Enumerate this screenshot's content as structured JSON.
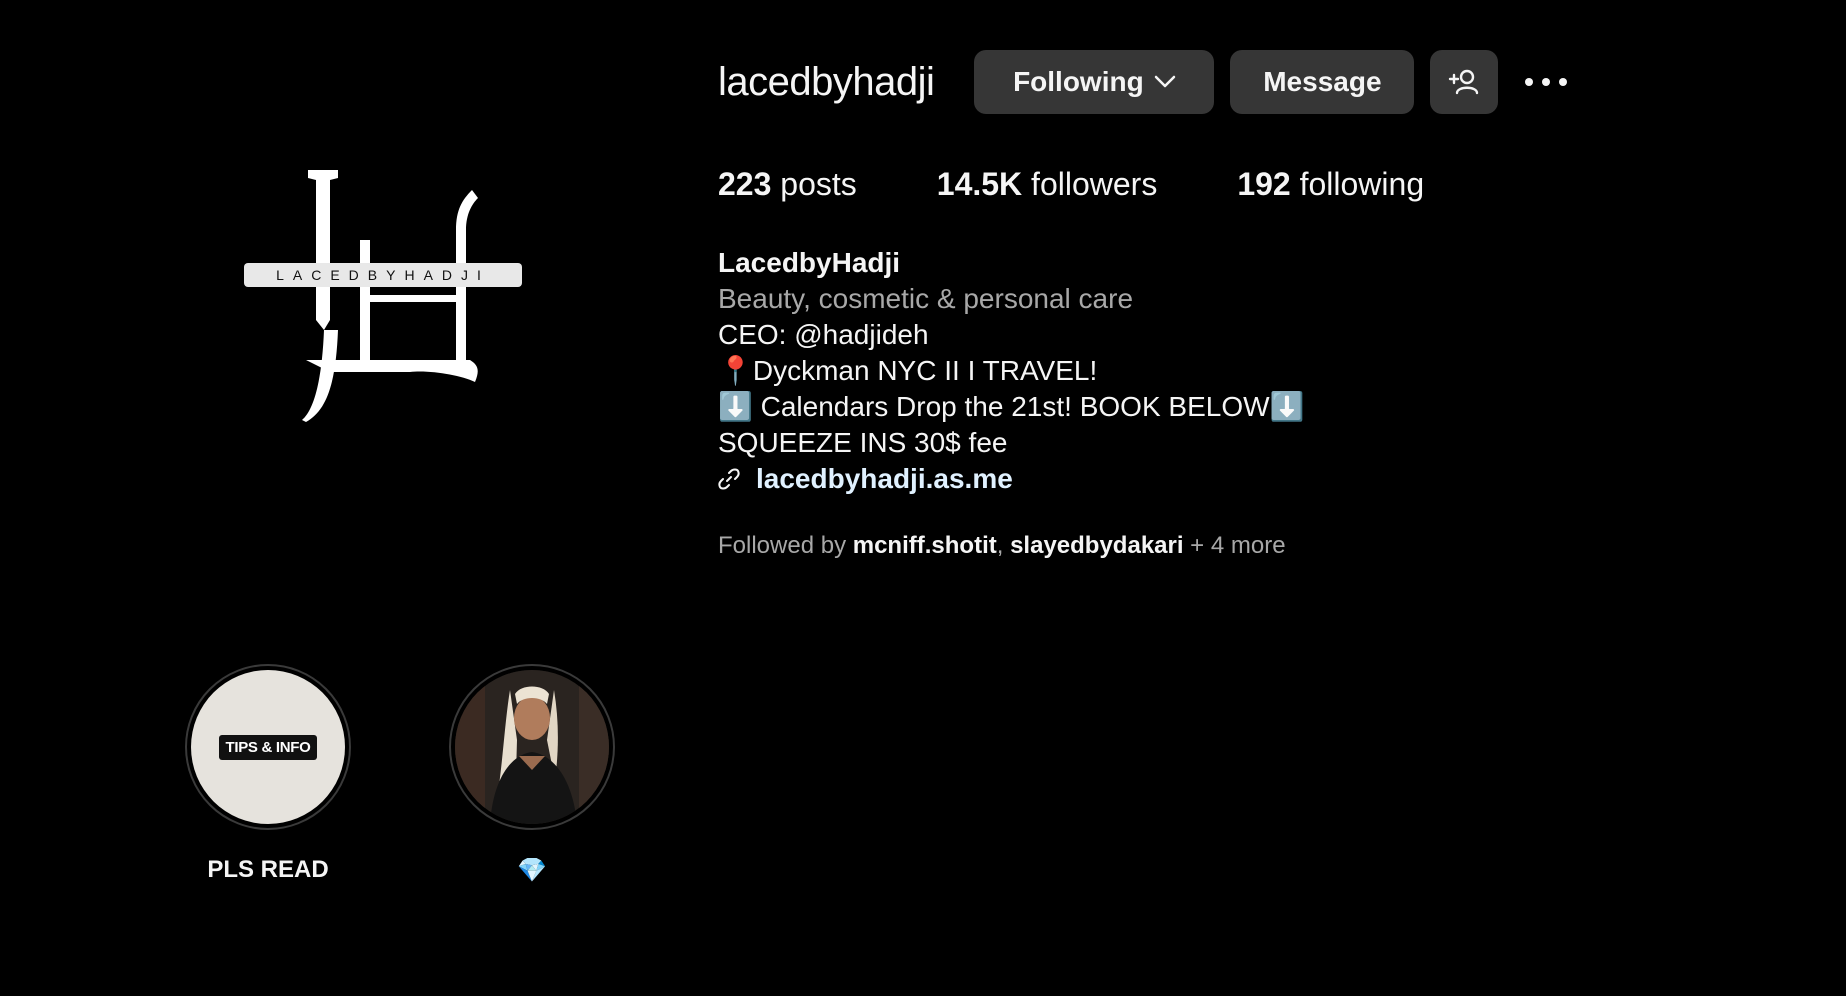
{
  "profile": {
    "username": "lacedbyhadji",
    "logo_text": "LACEDBYHADJI",
    "logo_monogram": "LH"
  },
  "actions": {
    "following_label": "Following",
    "message_label": "Message",
    "add_user_icon": "person-plus-icon",
    "more_icon": "ellipsis-icon"
  },
  "stats": {
    "posts_count": "223",
    "posts_label": " posts",
    "followers_count": "14.5K",
    "followers_label": " followers",
    "following_count": "192",
    "following_label": " following"
  },
  "bio": {
    "display_name": "LacedbyHadji",
    "category": "Beauty, cosmetic & personal care",
    "lines": [
      "CEO: @hadjideh",
      "📍Dyckman NYC II I TRAVEL!",
      "⬇️ Calendars Drop the 21st! BOOK BELOW⬇️",
      "SQUEEZE INS 30$ fee"
    ],
    "link_icon": "link-icon",
    "link": "lacedbyhadji.as.me"
  },
  "followed_by": {
    "prefix": "Followed by ",
    "accounts": [
      "mcniff.shotit",
      "slayedbydakari"
    ],
    "separator": ", ",
    "suffix": " + 4 more"
  },
  "highlights": [
    {
      "label": "PLS READ",
      "cover_text": "TIPS & INFO"
    },
    {
      "label": "💎",
      "cover_text": ""
    }
  ],
  "colors": {
    "background": "#000000",
    "button": "#363636",
    "text": "#f5f5f5",
    "secondary_text": "#a8a8a8",
    "link": "#e0f1ff"
  }
}
